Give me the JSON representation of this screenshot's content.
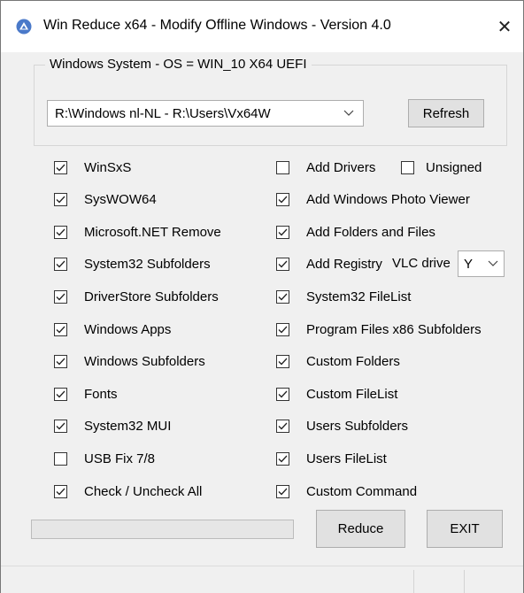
{
  "window": {
    "title": "Win Reduce x64 - Modify Offline Windows - Version 4.0",
    "close_glyph": "✕",
    "accent_color": "#4a79c9"
  },
  "system_group": {
    "legend": "Windows System  -  OS = WIN_10 X64  UEFI",
    "selected_image": "R:\\Windows nl-NL  -  R:\\Users\\Vx64W",
    "refresh_label": "Refresh"
  },
  "left_options": [
    {
      "label": "WinSxS",
      "checked": true
    },
    {
      "label": "SysWOW64",
      "checked": true
    },
    {
      "label": "Microsoft.NET Remove",
      "checked": true
    },
    {
      "label": "System32 Subfolders",
      "checked": true
    },
    {
      "label": "DriverStore Subfolders",
      "checked": true
    },
    {
      "label": "Windows Apps",
      "checked": true
    },
    {
      "label": "Windows Subfolders",
      "checked": true
    },
    {
      "label": "Fonts",
      "checked": true
    },
    {
      "label": "System32 MUI",
      "checked": true
    },
    {
      "label": "USB Fix 7/8",
      "checked": false
    },
    {
      "label": "Check / Uncheck All",
      "checked": true
    }
  ],
  "right_options": [
    {
      "label": "Add Drivers",
      "checked": false
    },
    {
      "label": "Add Windows Photo Viewer",
      "checked": true
    },
    {
      "label": "Add Folders and Files",
      "checked": true
    },
    {
      "label": "Add Registry",
      "checked": true
    },
    {
      "label": "System32 FileList",
      "checked": true
    },
    {
      "label": "Program Files x86 Subfolders",
      "checked": true
    },
    {
      "label": "Custom Folders",
      "checked": true
    },
    {
      "label": "Custom FileList",
      "checked": true
    },
    {
      "label": "Users Subfolders",
      "checked": true
    },
    {
      "label": "Users FileList",
      "checked": true
    },
    {
      "label": "Custom Command",
      "checked": true
    }
  ],
  "unsigned_option": {
    "label": "Unsigned",
    "checked": false
  },
  "vlc_drive": {
    "label": "VLC drive",
    "value": "Y"
  },
  "progress": {
    "value": 0
  },
  "actions": {
    "reduce_label": "Reduce",
    "exit_label": "EXIT"
  }
}
